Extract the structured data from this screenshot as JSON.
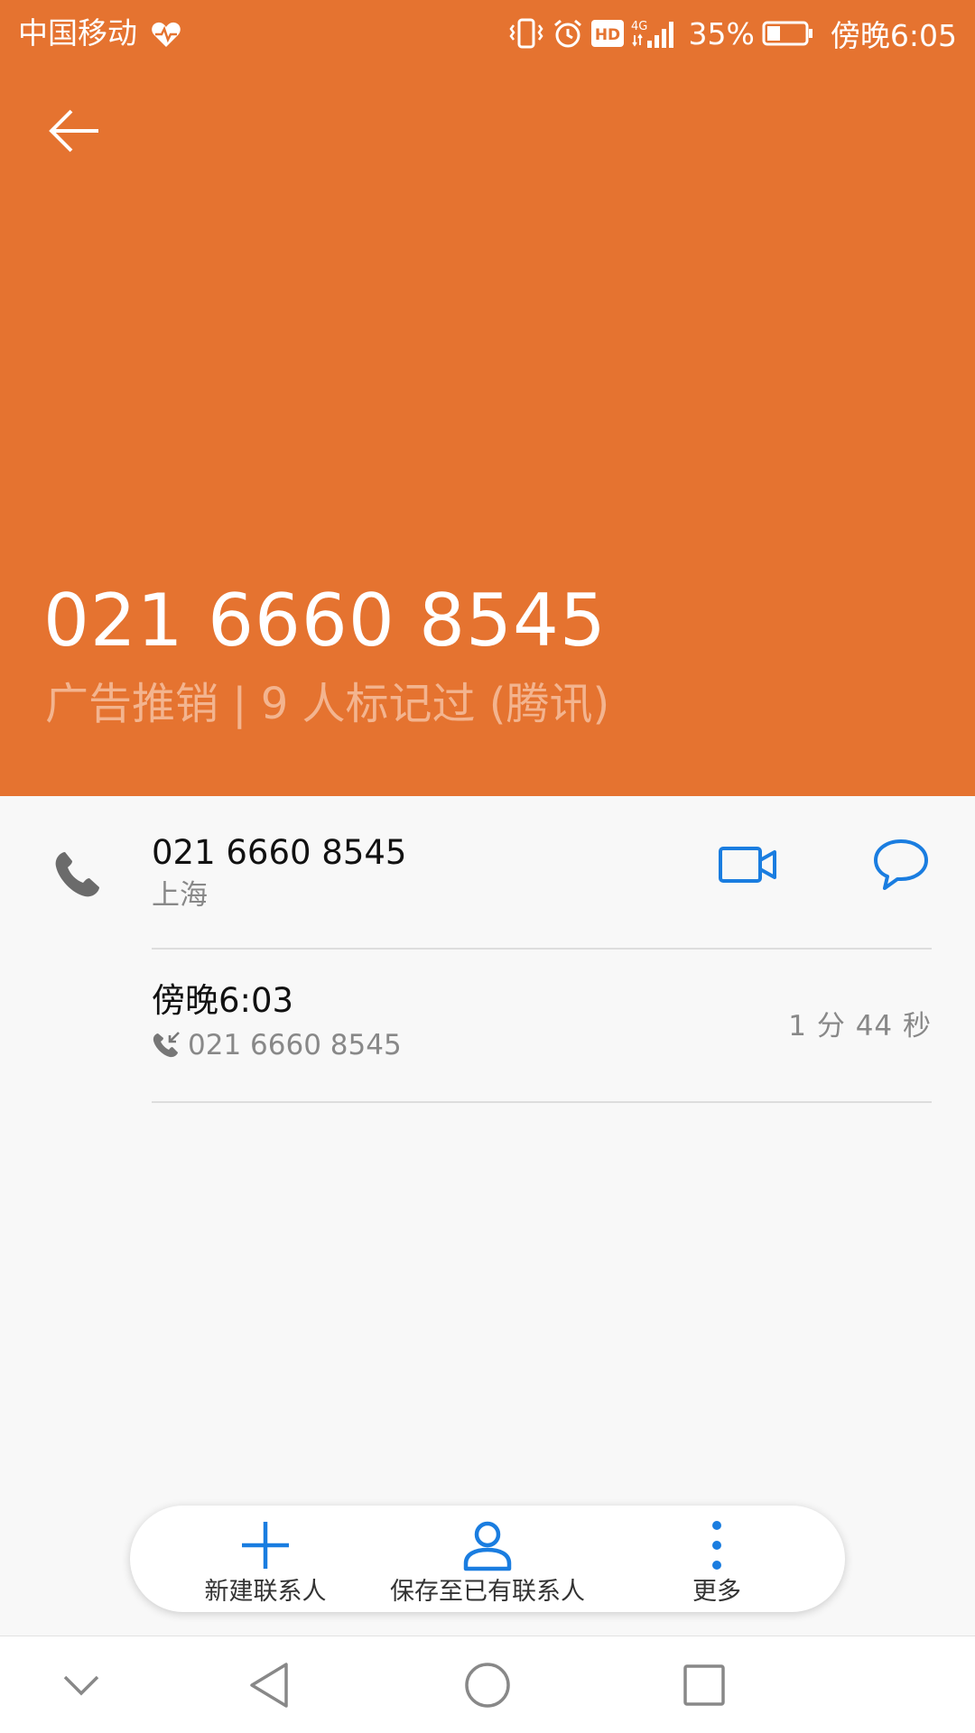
{
  "status_bar": {
    "carrier": "中国移动",
    "battery_percent": "35%",
    "network": "4G",
    "hd_label": "HD",
    "time": "傍晚6:05"
  },
  "header": {
    "phone_number": "021 6660 8545",
    "tag_line": "广告推销 | 9 人标记过 (腾讯)",
    "background_color": "#e57330"
  },
  "contact_row": {
    "number": "021 6660 8545",
    "location": "上海"
  },
  "call_log": [
    {
      "time": "傍晚6:03",
      "number": "021 6660 8545",
      "duration": "1 分 44 秒"
    }
  ],
  "actions": {
    "new_contact": "新建联系人",
    "save_existing": "保存至已有联系人",
    "more": "更多"
  },
  "colors": {
    "accent_blue": "#1a7de0",
    "header_orange": "#e57330"
  }
}
